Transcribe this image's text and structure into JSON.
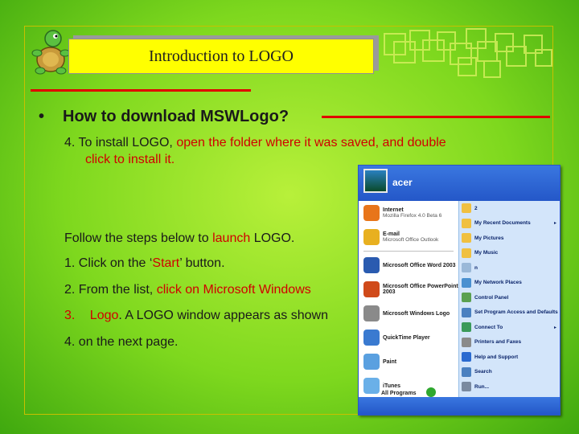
{
  "slide": {
    "title": "Introduction to LOGO",
    "bullet": "•",
    "heading": "How to download MSWLogo?",
    "step4_prefix": "4. To install LOGO, ",
    "step4_red": "open the folder where it was saved, and double",
    "step4_line2": "click to install it.",
    "follow_prefix": "Follow the steps below to ",
    "follow_red": "launch",
    "follow_suffix": " LOGO.",
    "item1_prefix": "1.  Click on the ‘",
    "item1_red": "Start",
    "item1_suffix": "’ button.",
    "item2_prefix": "2.  From the list, ",
    "item2_red": "click on Microsoft Windows",
    "item3_num": "3.",
    "item3_red": "Logo",
    "item3_suffix": ". A LOGO window appears as shown",
    "item4": "4.  on the next page."
  },
  "start_menu": {
    "user": "acer",
    "left_items": [
      {
        "title": "Internet",
        "sub": "Mozilla Firefox 4.0 Beta 6",
        "icon": "firefox-icon",
        "color": "#e8751a"
      },
      {
        "title": "E-mail",
        "sub": "Microsoft Office Outlook",
        "icon": "outlook-icon",
        "color": "#e8b020"
      },
      {
        "title": "Microsoft Office Word 2003",
        "sub": "",
        "icon": "word-icon",
        "color": "#2a5bb0"
      },
      {
        "title": "Microsoft Office PowerPoint 2003",
        "sub": "",
        "icon": "powerpoint-icon",
        "color": "#d04a1a"
      },
      {
        "title": "Microsoft Windows Logo",
        "sub": "",
        "icon": "mswlogo-icon",
        "color": "#8a8a8a"
      },
      {
        "title": "QuickTime Player",
        "sub": "",
        "icon": "quicktime-icon",
        "color": "#3a7ad0"
      },
      {
        "title": "Paint",
        "sub": "",
        "icon": "paint-icon",
        "color": "#5aa0e0"
      },
      {
        "title": "iTunes",
        "sub": "",
        "icon": "itunes-icon",
        "color": "#6ab0e8"
      }
    ],
    "right_items": [
      {
        "label": "2",
        "icon": "folder-icon",
        "color": "#f0c040",
        "arrow": ""
      },
      {
        "label": "My Recent Documents",
        "icon": "recent-docs-icon",
        "color": "#f0c040",
        "arrow": "▸"
      },
      {
        "label": "My Pictures",
        "icon": "pictures-icon",
        "color": "#f0c040",
        "arrow": ""
      },
      {
        "label": "My Music",
        "icon": "music-icon",
        "color": "#f0c040",
        "arrow": ""
      },
      {
        "label": "n",
        "icon": "computer-icon",
        "color": "#9ab8d8",
        "arrow": ""
      },
      {
        "label": "My Network Places",
        "icon": "network-icon",
        "color": "#4a90d0",
        "arrow": ""
      },
      {
        "label": "Control Panel",
        "icon": "control-panel-icon",
        "color": "#5aa050",
        "arrow": ""
      },
      {
        "label": "Set Program Access and Defaults",
        "icon": "defaults-icon",
        "color": "#4a80c0",
        "arrow": ""
      },
      {
        "label": "Connect To",
        "icon": "connect-icon",
        "color": "#3a9a5a",
        "arrow": "▸"
      },
      {
        "label": "Printers and Faxes",
        "icon": "printer-icon",
        "color": "#8a8a8a",
        "arrow": ""
      },
      {
        "label": "Help and Support",
        "icon": "help-icon",
        "color": "#2a6ad0",
        "arrow": ""
      },
      {
        "label": "Search",
        "icon": "search-icon",
        "color": "#4a80c0",
        "arrow": ""
      },
      {
        "label": "Run...",
        "icon": "run-icon",
        "color": "#7a8aa0",
        "arrow": ""
      }
    ],
    "all_programs": "All Programs"
  }
}
